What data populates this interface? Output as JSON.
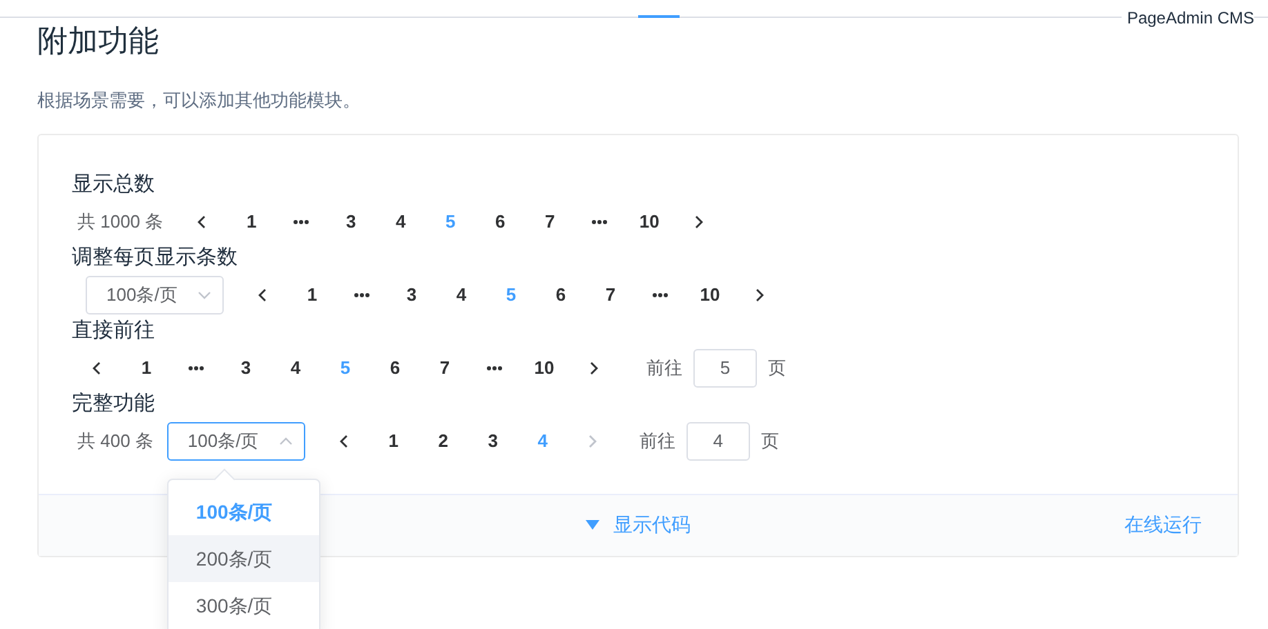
{
  "brand": "PageAdmin CMS",
  "title": "附加功能",
  "description": "根据场景需要，可以添加其他功能模块。",
  "sections": [
    {
      "title": "显示总数",
      "total": "共 1000 条",
      "pages": [
        {
          "kind": "prev",
          "disabled": false
        },
        {
          "kind": "page",
          "label": "1",
          "selected": false
        },
        {
          "kind": "ellipsis"
        },
        {
          "kind": "page",
          "label": "3",
          "selected": false
        },
        {
          "kind": "page",
          "label": "4",
          "selected": false
        },
        {
          "kind": "page",
          "label": "5",
          "selected": true
        },
        {
          "kind": "page",
          "label": "6",
          "selected": false
        },
        {
          "kind": "page",
          "label": "7",
          "selected": false
        },
        {
          "kind": "ellipsis"
        },
        {
          "kind": "page",
          "label": "10",
          "selected": false
        },
        {
          "kind": "next",
          "disabled": false
        }
      ]
    },
    {
      "title": "调整每页显示条数",
      "size_select": {
        "value": "100条/页",
        "expanded": false
      },
      "pages": [
        {
          "kind": "prev",
          "disabled": false
        },
        {
          "kind": "page",
          "label": "1",
          "selected": false
        },
        {
          "kind": "ellipsis"
        },
        {
          "kind": "page",
          "label": "3",
          "selected": false
        },
        {
          "kind": "page",
          "label": "4",
          "selected": false
        },
        {
          "kind": "page",
          "label": "5",
          "selected": true
        },
        {
          "kind": "page",
          "label": "6",
          "selected": false
        },
        {
          "kind": "page",
          "label": "7",
          "selected": false
        },
        {
          "kind": "ellipsis"
        },
        {
          "kind": "page",
          "label": "10",
          "selected": false
        },
        {
          "kind": "next",
          "disabled": false
        }
      ]
    },
    {
      "title": "直接前往",
      "pages": [
        {
          "kind": "prev",
          "disabled": false
        },
        {
          "kind": "page",
          "label": "1",
          "selected": false
        },
        {
          "kind": "ellipsis"
        },
        {
          "kind": "page",
          "label": "3",
          "selected": false
        },
        {
          "kind": "page",
          "label": "4",
          "selected": false
        },
        {
          "kind": "page",
          "label": "5",
          "selected": true
        },
        {
          "kind": "page",
          "label": "6",
          "selected": false
        },
        {
          "kind": "page",
          "label": "7",
          "selected": false
        },
        {
          "kind": "ellipsis"
        },
        {
          "kind": "page",
          "label": "10",
          "selected": false
        },
        {
          "kind": "next",
          "disabled": false
        }
      ],
      "jumper": {
        "label": "前往",
        "value": "5",
        "suffix": "页"
      }
    },
    {
      "title": "完整功能",
      "total": "共 400 条",
      "size_select": {
        "value": "100条/页",
        "expanded": true,
        "options": [
          {
            "label": "100条/页",
            "selected": true,
            "hovered": false
          },
          {
            "label": "200条/页",
            "selected": false,
            "hovered": true
          },
          {
            "label": "300条/页",
            "selected": false,
            "hovered": false
          }
        ]
      },
      "pages": [
        {
          "kind": "prev",
          "disabled": false
        },
        {
          "kind": "page",
          "label": "1",
          "selected": false
        },
        {
          "kind": "page",
          "label": "2",
          "selected": false
        },
        {
          "kind": "page",
          "label": "3",
          "selected": false
        },
        {
          "kind": "page",
          "label": "4",
          "selected": true
        },
        {
          "kind": "next",
          "disabled": true
        }
      ],
      "jumper": {
        "label": "前往",
        "value": "4",
        "suffix": "页"
      }
    }
  ],
  "footer": {
    "show_code": "显示代码",
    "run_online": "在线运行"
  }
}
